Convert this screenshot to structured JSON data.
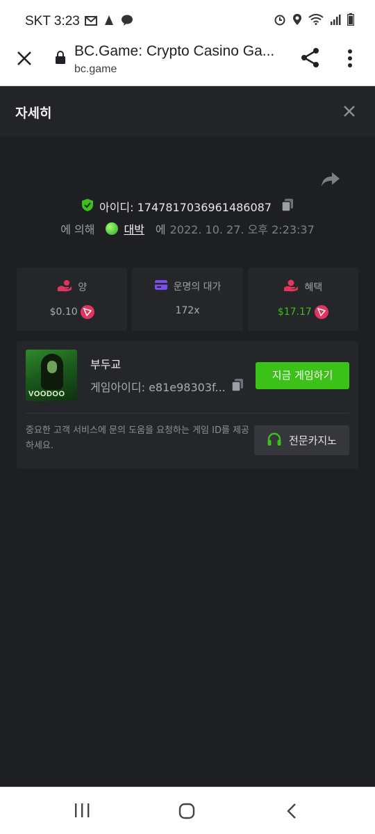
{
  "status_bar": {
    "carrier": "SKT",
    "time": "3:23"
  },
  "browser": {
    "title": "BC.Game: Crypto Casino Ga...",
    "url": "bc.game"
  },
  "modal": {
    "title": "자세히"
  },
  "bet": {
    "id_label": "아이디: 1747817036961486087",
    "by_label": "에 의해",
    "user": "대박",
    "at_label": "에",
    "timestamp": "2022. 10. 27. 오후 2:23:37"
  },
  "stats": [
    {
      "label": "양",
      "value": "$0.10"
    },
    {
      "label": "운명의 대가",
      "value": "172x"
    },
    {
      "label": "혜택",
      "value": "$17.17"
    }
  ],
  "game": {
    "thumb_text": "VOODOO",
    "name": "부두교",
    "game_id": "게임아이디: e81e98303f...",
    "play_label": "지금 게임하기",
    "help_text": "중요한 고객 서비스에 문의 도움을 요청하는 게임 ID를 제공하세요.",
    "support_label": "전문카지노"
  },
  "colors": {
    "accent_green": "#3bc117",
    "tron_red": "#e2345f",
    "purple": "#7b4cf0"
  }
}
